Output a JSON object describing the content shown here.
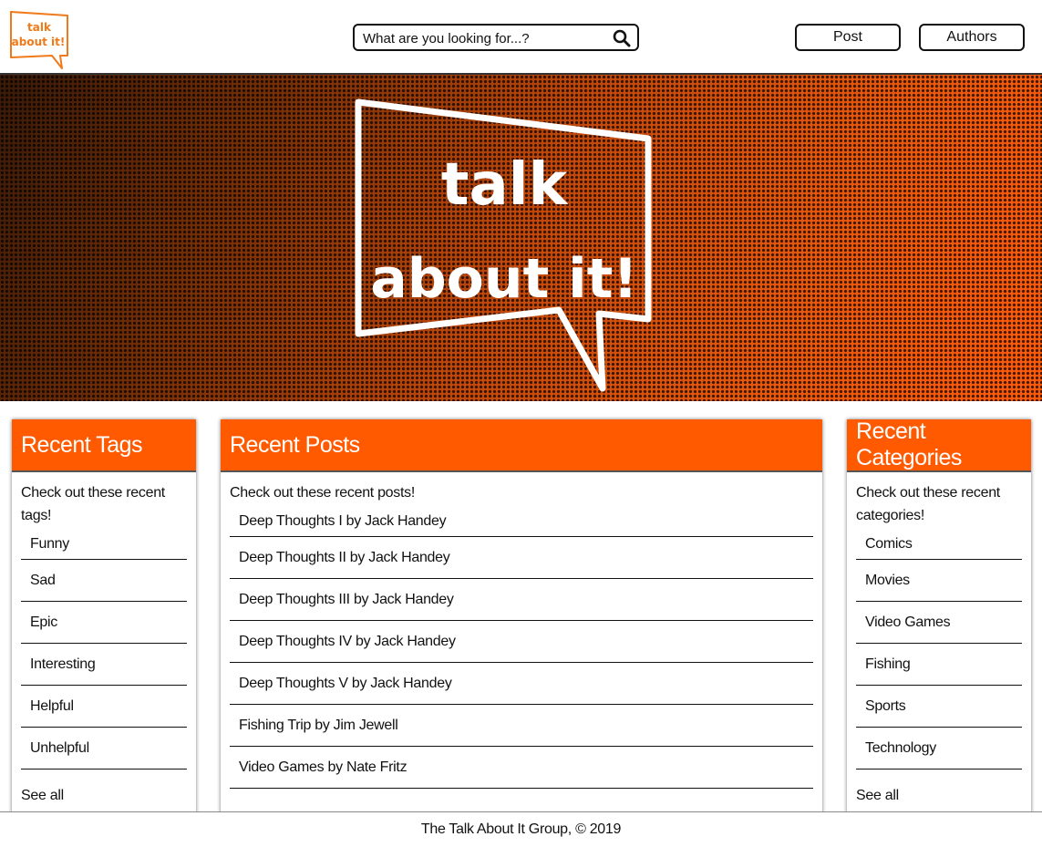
{
  "header": {
    "logo_line1": "talk",
    "logo_line2": "about it!",
    "search_placeholder": "What are you looking for...?",
    "post_label": "Post",
    "authors_label": "Authors"
  },
  "hero": {
    "line1": "talk",
    "line2": "about it!"
  },
  "tags": {
    "title": "Recent Tags",
    "intro": "Check out these recent tags!",
    "items": [
      "Funny",
      "Sad",
      "Epic",
      "Interesting",
      "Helpful",
      "Unhelpful"
    ],
    "see_all": "See all"
  },
  "posts": {
    "title": "Recent Posts",
    "intro": "Check out these recent posts!",
    "items": [
      "Deep Thoughts I by Jack Handey",
      "Deep Thoughts II by Jack Handey",
      "Deep Thoughts III by Jack Handey",
      "Deep Thoughts IV by Jack Handey",
      "Deep Thoughts V by Jack Handey",
      "Fishing Trip by Jim Jewell",
      "Video Games by Nate Fritz"
    ]
  },
  "categories": {
    "title": "Recent Categories",
    "intro": "Check out these recent categories!",
    "items": [
      "Comics",
      "Movies",
      "Video Games",
      "Fishing",
      "Sports",
      "Technology"
    ],
    "see_all": "See all"
  },
  "footer": {
    "text": "The Talk About It Group, © 2019"
  },
  "colors": {
    "accent": "#ff5a00",
    "logo_orange": "#f07a1a"
  }
}
